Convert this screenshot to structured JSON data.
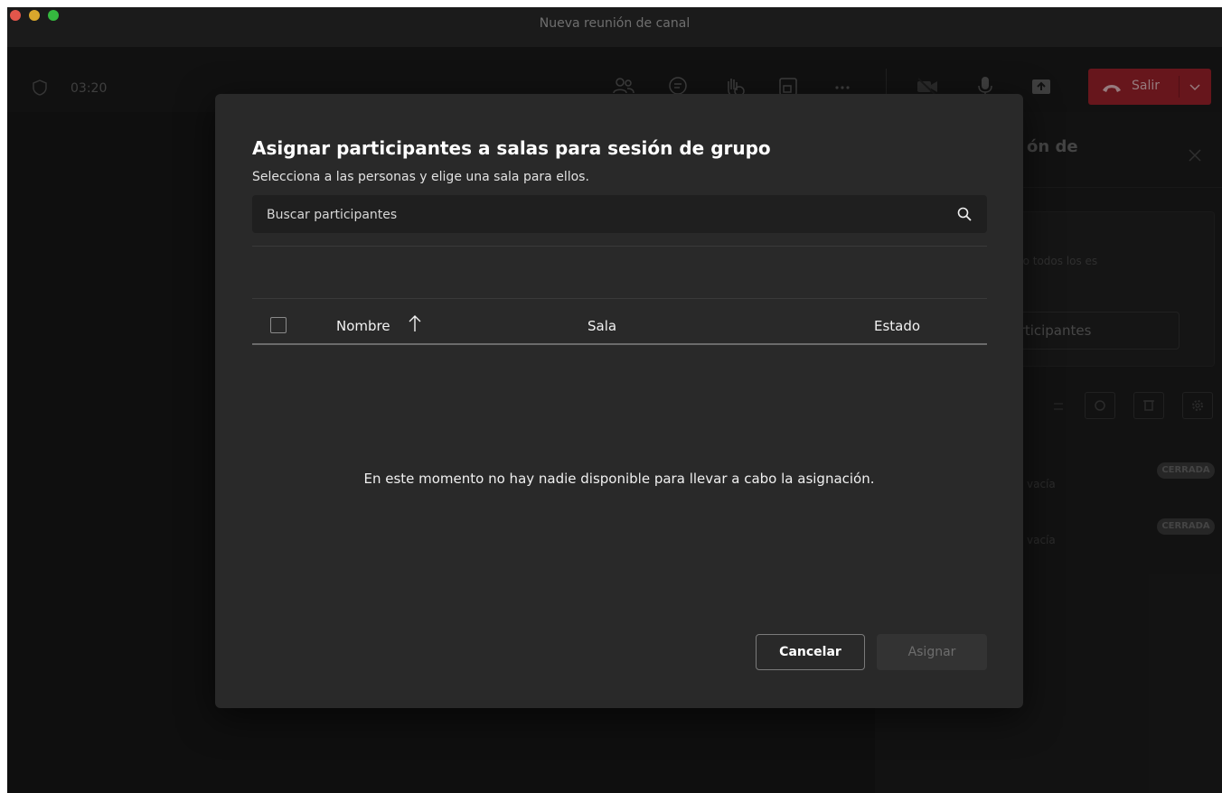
{
  "window": {
    "title": "Nueva reunión de canal"
  },
  "toolbar": {
    "timer": "03:20",
    "leave_label": "Salir",
    "icons": [
      "people-icon",
      "chat-icon",
      "raise-hand-icon",
      "breakout-rooms-icon",
      "more-icon",
      "camera-off-icon",
      "mic-icon",
      "share-icon"
    ]
  },
  "side_panel": {
    "title_fragment": "ón de",
    "card_text": "nado todos los es",
    "assign_button_label": "r participantes",
    "rooms": [
      {
        "sub": "vacía",
        "status": "CERRADA"
      },
      {
        "sub": "vacía",
        "status": "CERRADA"
      }
    ]
  },
  "modal": {
    "title": "Asignar participantes a salas para sesión de grupo",
    "subtitle": "Selecciona a las personas y elige una sala para ellos.",
    "search_placeholder": "Buscar participantes",
    "columns": {
      "name": "Nombre",
      "room": "Sala",
      "status": "Estado"
    },
    "empty_message": "En este momento no hay nadie disponible para llevar a cabo la asignación.",
    "cancel_label": "Cancelar",
    "assign_label": "Asignar"
  },
  "colors": {
    "leave_button": "#8a1e26",
    "modal_bg": "#292929",
    "app_bg": "#141414"
  }
}
